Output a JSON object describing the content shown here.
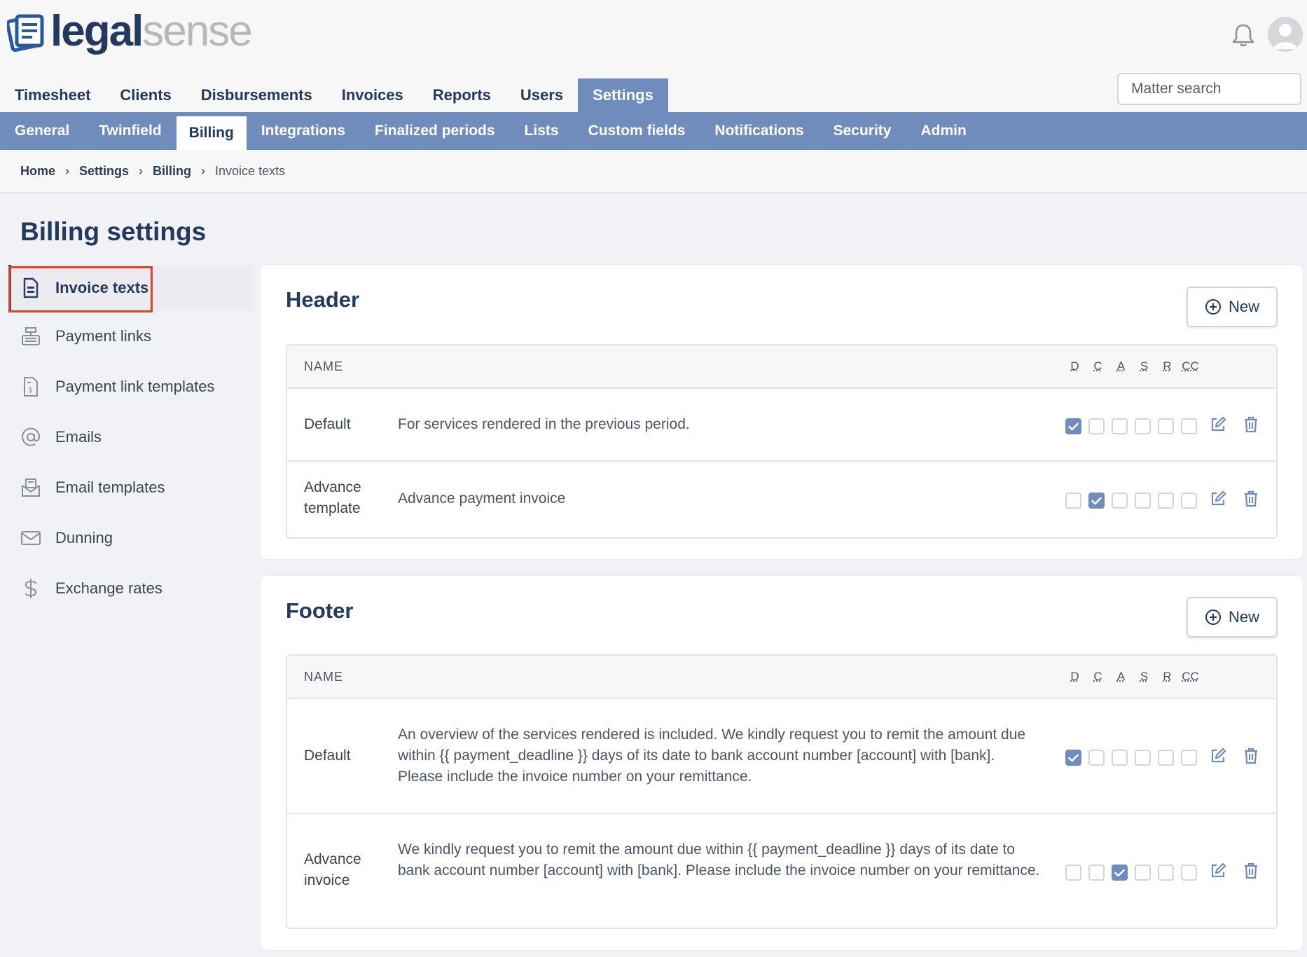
{
  "brand": {
    "name_part1": "legal",
    "name_part2": "sense"
  },
  "main_nav": [
    {
      "label": "Timesheet",
      "active": false
    },
    {
      "label": "Clients",
      "active": false
    },
    {
      "label": "Disbursements",
      "active": false
    },
    {
      "label": "Invoices",
      "active": false
    },
    {
      "label": "Reports",
      "active": false
    },
    {
      "label": "Users",
      "active": false
    },
    {
      "label": "Settings",
      "active": true
    }
  ],
  "search": {
    "placeholder": "Matter search"
  },
  "sub_nav": [
    {
      "label": "General"
    },
    {
      "label": "Twinfield"
    },
    {
      "label": "Billing"
    },
    {
      "label": "Integrations"
    },
    {
      "label": "Finalized periods"
    },
    {
      "label": "Lists"
    },
    {
      "label": "Custom fields"
    },
    {
      "label": "Notifications"
    },
    {
      "label": "Security"
    },
    {
      "label": "Admin"
    }
  ],
  "breadcrumb": {
    "home": "Home",
    "settings": "Settings",
    "billing": "Billing",
    "current": "Invoice texts"
  },
  "page_title": "Billing settings",
  "sidebar": [
    {
      "label": "Invoice texts",
      "icon": "document-icon"
    },
    {
      "label": "Payment links",
      "icon": "cash-register-icon"
    },
    {
      "label": "Payment link templates",
      "icon": "invoice-dollar-icon"
    },
    {
      "label": "Emails",
      "icon": "at-icon"
    },
    {
      "label": "Email templates",
      "icon": "envelope-open-icon"
    },
    {
      "label": "Dunning",
      "icon": "envelope-icon"
    },
    {
      "label": "Exchange rates",
      "icon": "dollar-icon"
    }
  ],
  "flag_headers": [
    "D",
    "C",
    "A",
    "S",
    "R",
    "CC"
  ],
  "header_section": {
    "title": "Header",
    "new_label": "New",
    "col_name": "NAME",
    "rows": [
      {
        "name": "Default",
        "text": "For services rendered in the previous period.",
        "flags": [
          true,
          false,
          false,
          false,
          false,
          false
        ]
      },
      {
        "name": "Advance template",
        "text": "Advance payment invoice",
        "flags": [
          false,
          true,
          false,
          false,
          false,
          false
        ]
      }
    ]
  },
  "footer_section": {
    "title": "Footer",
    "new_label": "New",
    "col_name": "NAME",
    "rows": [
      {
        "name": "Default",
        "text": "An overview of the services rendered is included. We kindly request you to remit the amount due within {{ payment_deadline }} days of its date to bank account number [account] with [bank]. Please include the invoice number on your remittance.",
        "flags": [
          true,
          false,
          false,
          false,
          false,
          false
        ]
      },
      {
        "name": "Advance invoice",
        "text": "We kindly request you to remit the amount due within {{ payment_deadline }} days of its date to bank account number [account] with [bank]. Please include the invoice number on your remittance.",
        "flags": [
          false,
          false,
          true,
          false,
          false,
          false
        ]
      }
    ]
  },
  "colors": {
    "accent": "#6f8cbc",
    "brand_dark": "#23395d",
    "highlight": "#e0432d"
  }
}
